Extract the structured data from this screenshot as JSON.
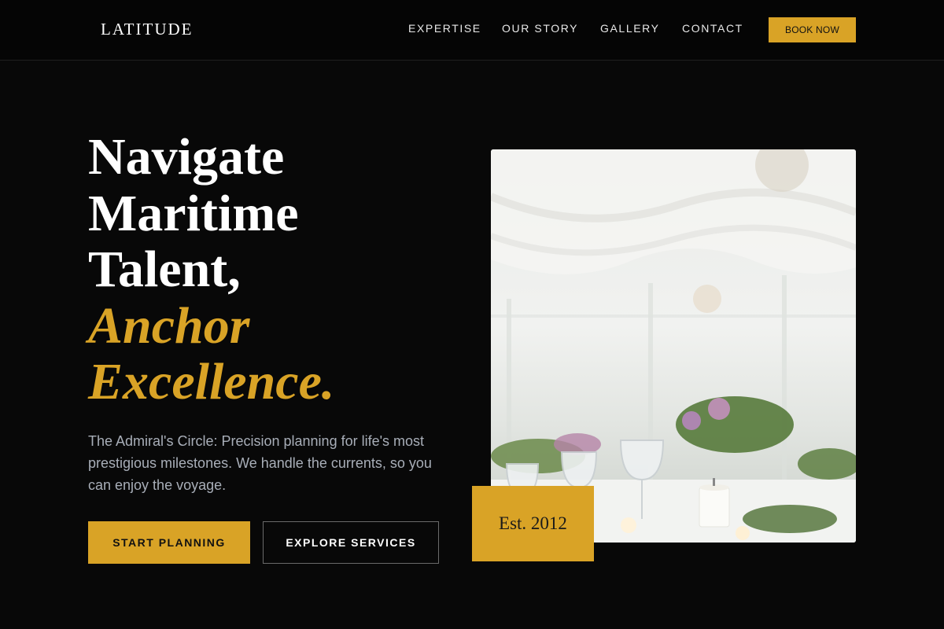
{
  "header": {
    "brand": "LATITUDE",
    "nav": [
      "EXPERTISE",
      "OUR STORY",
      "GALLERY",
      "CONTACT"
    ],
    "cta": "BOOK NOW"
  },
  "hero": {
    "title_lines": [
      "Navigate",
      "Maritime",
      "Talent,"
    ],
    "accent_lines": [
      "Anchor",
      "Excellence."
    ],
    "subtitle": "The Admiral's Circle: Precision planning for life's most prestigious milestones. We handle the currents, so you can enjoy the voyage.",
    "primary_button": "START PLANNING",
    "secondary_button": "EXPLORE SERVICES"
  },
  "badge": "Est. 2012",
  "colors": {
    "accent": "#d9a326",
    "background": "#080808"
  }
}
